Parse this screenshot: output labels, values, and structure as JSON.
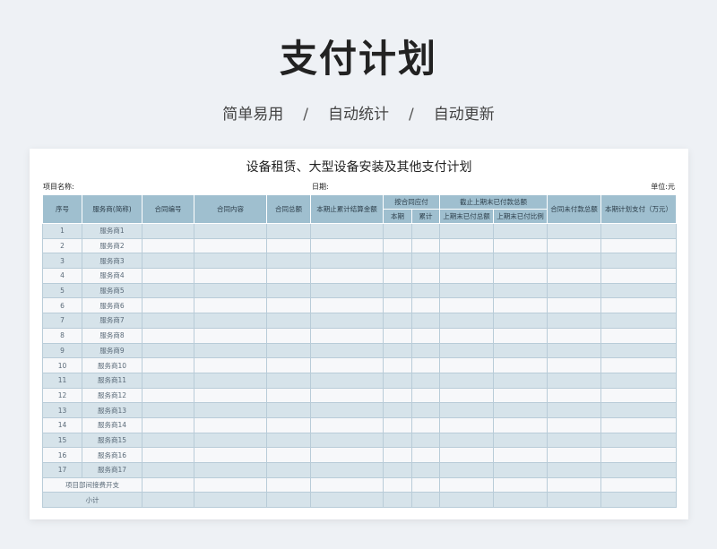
{
  "header": {
    "title": "支付计划",
    "tags": [
      "简单易用",
      "自动统计",
      "自动更新"
    ],
    "separator": "/"
  },
  "sheet": {
    "title": "设备租赁、大型设备安装及其他支付计划",
    "project_label": "项目名称:",
    "date_label": "日期:",
    "unit_label": "单位:元",
    "headers": {
      "seq": "序号",
      "vendor": "服务商(简称)",
      "contract_no": "合同编号",
      "contract_content": "合同内容",
      "contract_total": "合同总额",
      "settled": "本期止累计结算金额",
      "payable_group": "按合同应付",
      "payable_current": "本期",
      "payable_cumulative": "累计",
      "unpaid_group": "截止上期末已付款总额",
      "unpaid_total": "上期末已付总额",
      "unpaid_ratio": "上期末已付比例",
      "contract_unpaid": "合同未付款总额",
      "plan_pay": "本期计划支付（万元）"
    },
    "rows": [
      {
        "seq": "1",
        "vendor": "服务商1"
      },
      {
        "seq": "2",
        "vendor": "服务商2"
      },
      {
        "seq": "3",
        "vendor": "服务商3"
      },
      {
        "seq": "4",
        "vendor": "服务商4"
      },
      {
        "seq": "5",
        "vendor": "服务商5"
      },
      {
        "seq": "6",
        "vendor": "服务商6"
      },
      {
        "seq": "7",
        "vendor": "服务商7"
      },
      {
        "seq": "8",
        "vendor": "服务商8"
      },
      {
        "seq": "9",
        "vendor": "服务商9"
      },
      {
        "seq": "10",
        "vendor": "服务商10"
      },
      {
        "seq": "11",
        "vendor": "服务商11"
      },
      {
        "seq": "12",
        "vendor": "服务商12"
      },
      {
        "seq": "13",
        "vendor": "服务商13"
      },
      {
        "seq": "14",
        "vendor": "服务商14"
      },
      {
        "seq": "15",
        "vendor": "服务商15"
      },
      {
        "seq": "16",
        "vendor": "服务商16"
      },
      {
        "seq": "17",
        "vendor": "服务商17"
      }
    ],
    "footer_rows": [
      "项目部间接费开支",
      "小计"
    ]
  }
}
